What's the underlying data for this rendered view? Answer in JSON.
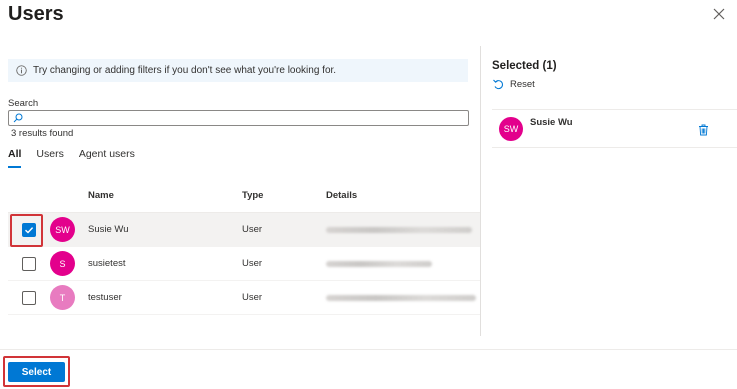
{
  "dialog": {
    "title": "Users",
    "close_icon": "close-icon"
  },
  "info_bar": {
    "text": "Try changing or adding filters if you don't see what you're looking for.",
    "icon": "info-icon"
  },
  "search": {
    "label": "Search",
    "value": "",
    "placeholder": "",
    "icon": "search-icon"
  },
  "results_text": "3 results found",
  "tabs": [
    {
      "label": "All",
      "active": true
    },
    {
      "label": "Users",
      "active": false
    },
    {
      "label": "Agent users",
      "active": false
    }
  ],
  "table": {
    "columns": [
      "Name",
      "Type",
      "Details"
    ],
    "rows": [
      {
        "initials": "SW",
        "name": "Susie Wu",
        "type": "User",
        "checked": true
      },
      {
        "initials": "S",
        "name": "susietest",
        "type": "User",
        "checked": false
      },
      {
        "initials": "T",
        "name": "testuser",
        "type": "User",
        "checked": false
      }
    ]
  },
  "selected_panel": {
    "title": "Selected (1)",
    "reset_label": "Reset",
    "items": [
      {
        "initials": "SW",
        "name": "Susie Wu"
      }
    ]
  },
  "footer": {
    "select_label": "Select"
  },
  "colors": {
    "accent": "#0078d4",
    "avatar_primary": "#e3008c",
    "avatar_light": "#e87bc0",
    "highlight": "#d13438",
    "info_bg": "#eff6fc"
  }
}
